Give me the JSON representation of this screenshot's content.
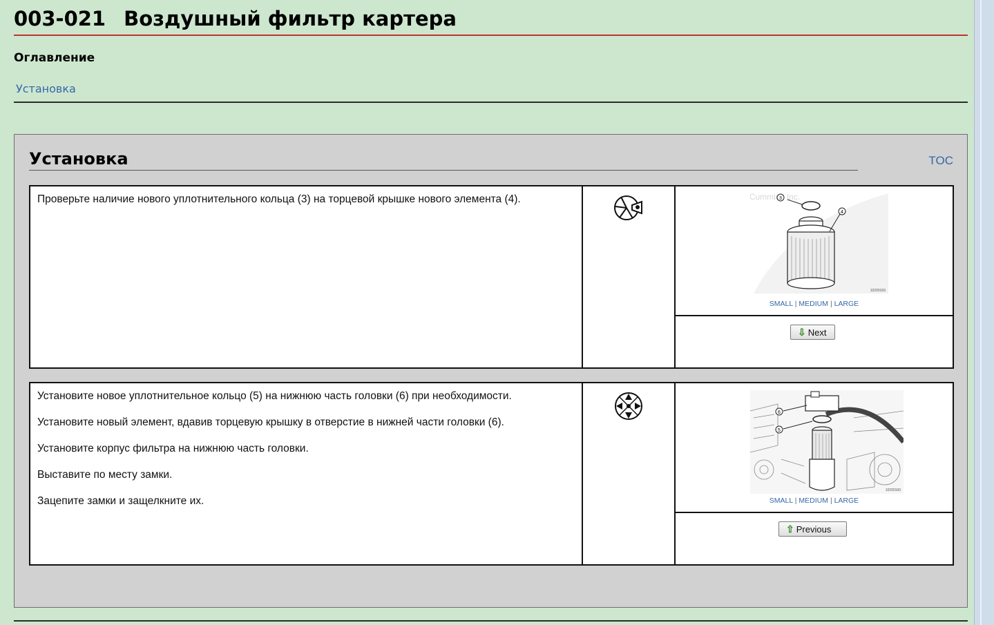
{
  "page": {
    "code": "003-021",
    "title": "Воздушный фильтр картера"
  },
  "toc": {
    "heading": "Оглавление",
    "links": [
      "Установка"
    ]
  },
  "section": {
    "title": "Установка",
    "toc_link": "TOC"
  },
  "steps": [
    {
      "paragraphs": [
        "Проверьте наличие нового уплотнительного кольца (3) на торцевой крышке нового элемента (4)."
      ],
      "icon": "inspect-icon",
      "image": {
        "watermark": "©Cummins Inc.",
        "callouts": [
          "3",
          "4"
        ],
        "figure_id": "10200169",
        "size_links": [
          "SMALL",
          "MEDIUM",
          "LARGE"
        ],
        "separator": "|"
      },
      "nav_button": {
        "label": "Next",
        "arrow": "⇩",
        "icon": "down-arrow-icon"
      }
    },
    {
      "paragraphs": [
        "Установите новое уплотнительное кольцо (5) на нижнюю часть головки (6) при необходимости.",
        "Установите новый элемент, вдавив торцевую крышку в отверстие в нижней части головки (6).",
        "Установите корпус фильтра на нижнюю часть головки.",
        "Выставите по месту замки.",
        "Зацепите замки и защелкните их."
      ],
      "icon": "install-icon",
      "image": {
        "callouts": [
          "6",
          "5"
        ],
        "figure_id": "10200160",
        "size_links": [
          "SMALL",
          "MEDIUM",
          "LARGE"
        ],
        "separator": "|"
      },
      "nav_button": {
        "label": "Previous",
        "arrow": "⇧",
        "icon": "up-arrow-icon"
      }
    }
  ],
  "colors": {
    "background": "#cde7cf",
    "title_rule": "#c0302c",
    "link": "#3667a6",
    "panel": "#d1d1d1"
  }
}
